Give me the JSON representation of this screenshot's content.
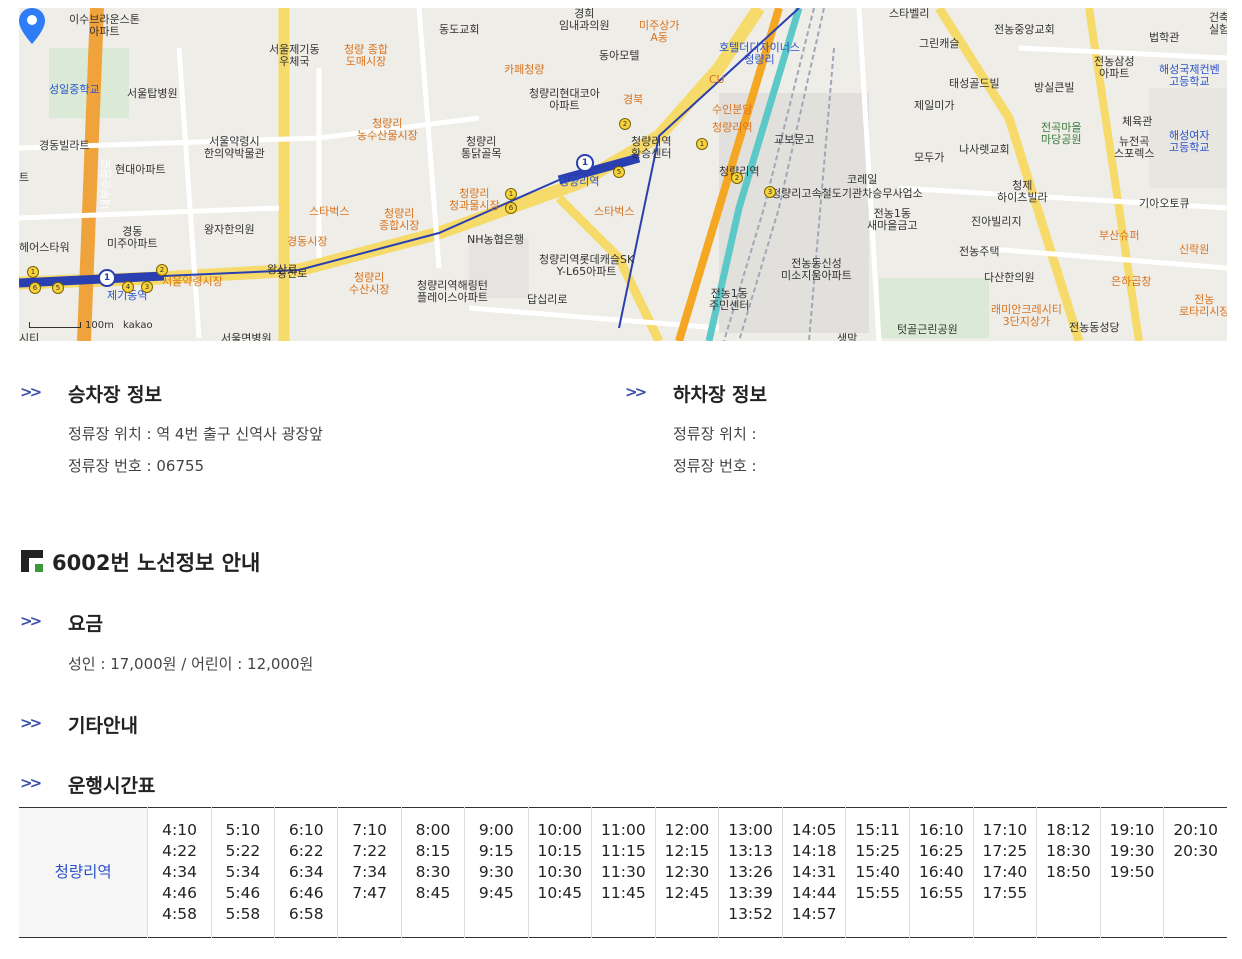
{
  "map": {
    "labels": [
      {
        "t": "이수브라운스톤\n아파트",
        "c": ""
      },
      {
        "t": "서울제기동\n우체국",
        "c": ""
      },
      {
        "t": "청량 종합\n도매시장",
        "c": "o"
      },
      {
        "t": "동도교회",
        "c": ""
      },
      {
        "t": "경희\n임내과의원",
        "c": ""
      },
      {
        "t": "미주상가\nA동",
        "c": "o"
      },
      {
        "t": "동아모텔",
        "c": ""
      },
      {
        "t": "호텔더디자이너스\n청량리",
        "c": "b"
      },
      {
        "t": "스타벨리",
        "c": ""
      },
      {
        "t": "그린캐슬",
        "c": ""
      },
      {
        "t": "전농중앙교회",
        "c": ""
      },
      {
        "t": "법학관",
        "c": ""
      },
      {
        "t": "성일중학교",
        "c": "b"
      },
      {
        "t": "서울탑병원",
        "c": ""
      },
      {
        "t": "카페청량",
        "c": "o"
      },
      {
        "t": "청량리현대코아\n아파트",
        "c": ""
      },
      {
        "t": "경북",
        "c": "o"
      },
      {
        "t": "CU",
        "c": "o"
      },
      {
        "t": "태성골드빌",
        "c": ""
      },
      {
        "t": "방실큰빌",
        "c": ""
      },
      {
        "t": "전농삼성\n아파트",
        "c": ""
      },
      {
        "t": "해성국제컨벤\n고등학교",
        "c": "b"
      },
      {
        "t": "제일미가",
        "c": ""
      },
      {
        "t": "수인분당",
        "c": "o"
      },
      {
        "t": "청량리역",
        "c": "o"
      },
      {
        "t": "청량리\n농수산물시장",
        "c": "o"
      },
      {
        "t": "경동빌라트",
        "c": ""
      },
      {
        "t": "현대아파트",
        "c": ""
      },
      {
        "t": "서울약령시\n한의약박물관",
        "c": ""
      },
      {
        "t": "청량리\n통닭골목",
        "c": ""
      },
      {
        "t": "청량리역\n환승센터",
        "c": ""
      },
      {
        "t": "교보문고",
        "c": ""
      },
      {
        "t": "나사렛교회",
        "c": ""
      },
      {
        "t": "전곡마을\n마당공원",
        "c": "g"
      },
      {
        "t": "체육관",
        "c": ""
      },
      {
        "t": "뉴전곡\n스포렉스",
        "c": ""
      },
      {
        "t": "해성여자\n고등학교",
        "c": "b"
      },
      {
        "t": "모두가",
        "c": ""
      },
      {
        "t": "청량리역",
        "c": "b"
      },
      {
        "t": "청량리역",
        "c": ""
      },
      {
        "t": "코레일",
        "c": ""
      },
      {
        "t": "스타벅스",
        "c": "o"
      },
      {
        "t": "청량리고속철도기관차승무사업소",
        "c": ""
      },
      {
        "t": "청제\n하이츠빌라",
        "c": ""
      },
      {
        "t": "기아오토큐",
        "c": ""
      },
      {
        "t": "청량리\n청과물시장",
        "c": "o"
      },
      {
        "t": "청량리\n종합시장",
        "c": "o"
      },
      {
        "t": "스타벅스",
        "c": "o"
      },
      {
        "t": "전농1동\n새마을금고",
        "c": ""
      },
      {
        "t": "진아빌리지",
        "c": ""
      },
      {
        "t": "헤어스타워",
        "c": ""
      },
      {
        "t": "경동\n미주아파트",
        "c": ""
      },
      {
        "t": "왕자한의원",
        "c": ""
      },
      {
        "t": "경동시장",
        "c": "o"
      },
      {
        "t": "NH농협은행",
        "c": ""
      },
      {
        "t": "전농주택",
        "c": ""
      },
      {
        "t": "부산슈퍼",
        "c": "o"
      },
      {
        "t": "신락원",
        "c": "o"
      },
      {
        "t": "제기동역",
        "c": "b"
      },
      {
        "t": "서울약령시장",
        "c": "o"
      },
      {
        "t": "왕산로",
        "c": ""
      },
      {
        "t": "청량리\n수산시장",
        "c": "o"
      },
      {
        "t": "청량리역롯데캐슬SK\nY-L65아파트",
        "c": ""
      },
      {
        "t": "전농동신성\n미소지움아파트",
        "c": ""
      },
      {
        "t": "다산한의원",
        "c": ""
      },
      {
        "t": "은하곱창",
        "c": "o"
      },
      {
        "t": "청량리역해링턴\n플레이스아파트",
        "c": ""
      },
      {
        "t": "답십리로",
        "c": ""
      },
      {
        "t": "전농1동\n주민센터",
        "c": ""
      },
      {
        "t": "래미안크레시티\n3단지상가",
        "c": "o"
      },
      {
        "t": "전농동성당",
        "c": ""
      },
      {
        "t": "전농\n로타리시장",
        "c": "o"
      },
      {
        "t": "텃골근린공원",
        "c": ""
      },
      {
        "t": "서울면병원",
        "c": ""
      },
      {
        "t": "내부순환로",
        "c": "o"
      },
      {
        "t": "왕산로",
        "c": ""
      },
      {
        "t": "트",
        "c": ""
      },
      {
        "t": "시티",
        "c": ""
      },
      {
        "t": "건축\n실험",
        "c": ""
      },
      {
        "t": "생막",
        "c": ""
      }
    ],
    "pin_label": "청량리역 환승센터",
    "scale_label": "100m",
    "brand": "kakao"
  },
  "boarding": {
    "title": "승차장 정보",
    "location": "정류장 위치 : 역 4번 출구 신역사 광장앞",
    "number": "정류장 번호 : 06755"
  },
  "alighting": {
    "title": "하차장 정보",
    "location": "정류장 위치 :",
    "number": "정류장 번호 :"
  },
  "route": {
    "title": "6002번 노선정보 안내",
    "fare_title": "요금",
    "fare_text": "성인 : 17,000원 / 어린이 : 12,000원",
    "other_title": "기타안내",
    "schedule_title": "운행시간표"
  },
  "arrow_glyph": ">>",
  "timetable": {
    "stop": "청량리역",
    "columns": [
      [
        "4:10",
        "4:22",
        "4:34",
        "4:46",
        "4:58"
      ],
      [
        "5:10",
        "5:22",
        "5:34",
        "5:46",
        "5:58"
      ],
      [
        "6:10",
        "6:22",
        "6:34",
        "6:46",
        "6:58"
      ],
      [
        "7:10",
        "7:22",
        "7:34",
        "7:47"
      ],
      [
        "8:00",
        "8:15",
        "8:30",
        "8:45"
      ],
      [
        "9:00",
        "9:15",
        "9:30",
        "9:45"
      ],
      [
        "10:00",
        "10:15",
        "10:30",
        "10:45"
      ],
      [
        "11:00",
        "11:15",
        "11:30",
        "11:45"
      ],
      [
        "12:00",
        "12:15",
        "12:30",
        "12:45"
      ],
      [
        "13:00",
        "13:13",
        "13:26",
        "13:39",
        "13:52"
      ],
      [
        "14:05",
        "14:18",
        "14:31",
        "14:44",
        "14:57"
      ],
      [
        "15:11",
        "15:25",
        "15:40",
        "15:55"
      ],
      [
        "16:10",
        "16:25",
        "16:40",
        "16:55"
      ],
      [
        "17:10",
        "17:25",
        "17:40",
        "17:55"
      ],
      [
        "18:12",
        "18:30",
        "18:50"
      ],
      [
        "19:10",
        "19:30",
        "19:50"
      ],
      [
        "20:10",
        "20:30"
      ]
    ]
  },
  "colors": {
    "accent_blue": "#2b52c9",
    "line1_blue": "#2a3fb0",
    "suin_yellow": "#f5a623",
    "gyeongui_teal": "#5cc8c8",
    "poi_orange": "#d9731e"
  }
}
